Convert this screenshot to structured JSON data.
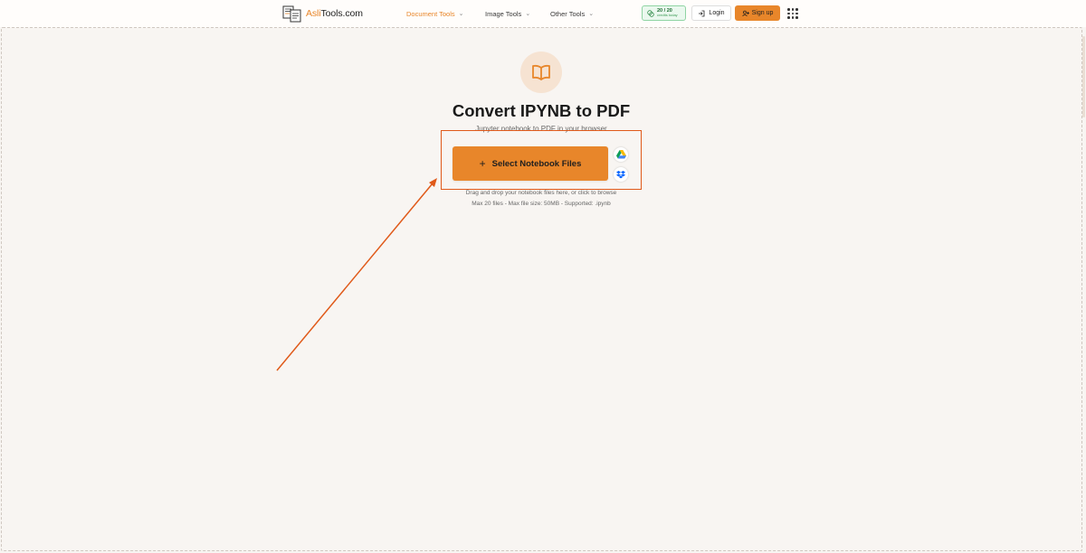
{
  "header": {
    "logo_prefix": "Asli",
    "logo_suffix": "Tools.com",
    "nav": [
      {
        "label": "Document Tools",
        "active": true
      },
      {
        "label": "Image Tools",
        "active": false
      },
      {
        "label": "Other Tools",
        "active": false
      }
    ],
    "credits": {
      "count": "20 / 20",
      "sub": "credits today"
    },
    "login_label": "Login",
    "signup_label": "Sign up"
  },
  "main": {
    "hero_icon": "book-open-icon",
    "title": "Convert IPYNB to PDF",
    "subtitle": "Jupyter notebook to PDF in your browser",
    "select_button_label": "Select Notebook Files",
    "hint_line1": "Drag and drop your notebook files here, or click to browse",
    "hint_line2": "Max 20 files - Max file size: 50MB - Supported: .ipynb"
  },
  "colors": {
    "accent": "#e8862a",
    "highlight": "#e05a1a",
    "background": "#f8f5f2"
  }
}
